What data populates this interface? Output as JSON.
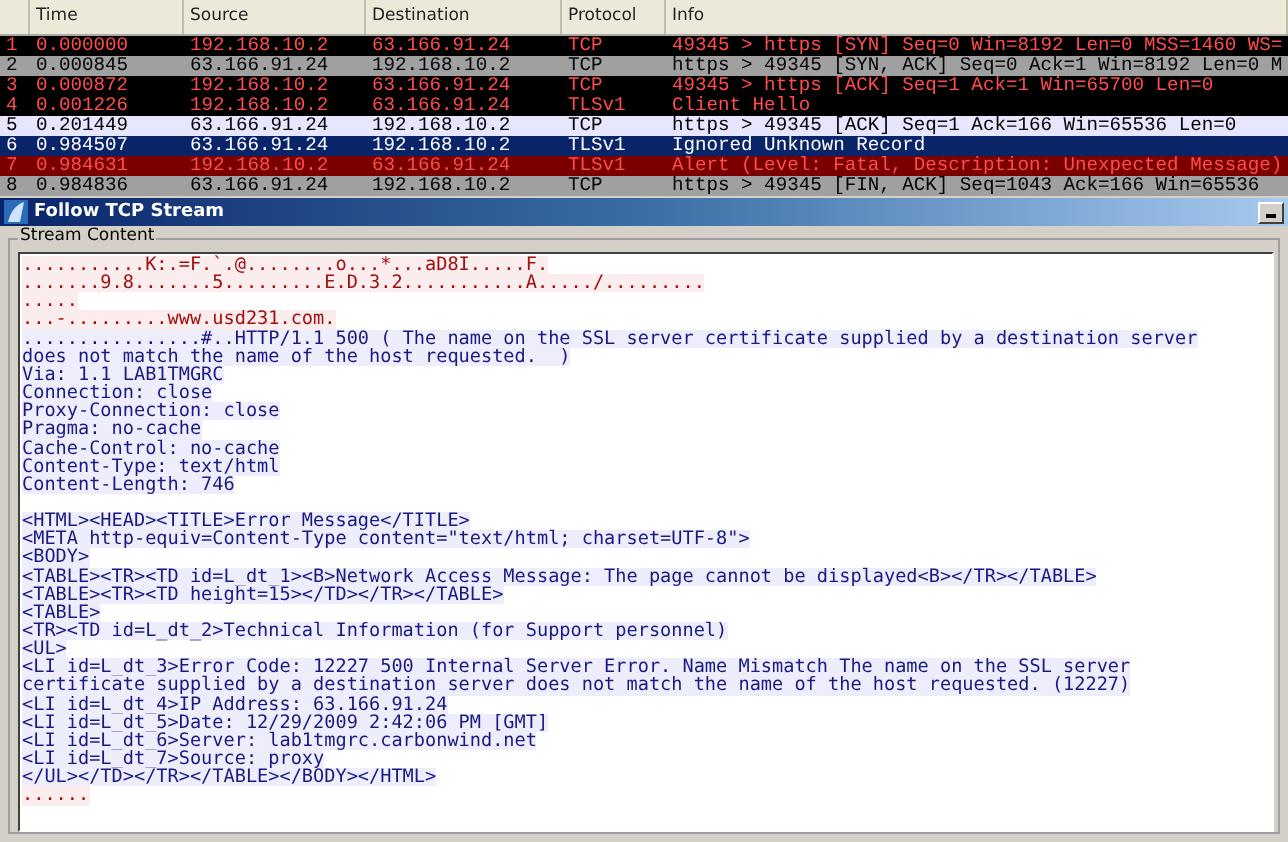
{
  "packet_list": {
    "columns": [
      "Time",
      "Source",
      "Destination",
      "Protocol",
      "Info"
    ],
    "rows": [
      {
        "no": "1",
        "time": "0.000000",
        "source": "192.168.10.2",
        "destination": "63.166.91.24",
        "protocol": "TCP",
        "info": "49345 > https [SYN] Seq=0 Win=8192 Len=0 MSS=1460 WS=",
        "color": "#000000",
        "kind": "bad",
        "selected": false
      },
      {
        "no": "2",
        "time": "0.000845",
        "source": "63.166.91.24",
        "destination": "192.168.10.2",
        "protocol": "TCP",
        "info": "https > 49345 [SYN, ACK] Seq=0 Ack=1 Win=8192 Len=0 M",
        "color": "#a0a0a0",
        "kind": "normal",
        "selected": false
      },
      {
        "no": "3",
        "time": "0.000872",
        "source": "192.168.10.2",
        "destination": "63.166.91.24",
        "protocol": "TCP",
        "info": "49345 > https [ACK] Seq=1 Ack=1 Win=65700 Len=0",
        "color": "#000000",
        "kind": "bad",
        "selected": false
      },
      {
        "no": "4",
        "time": "0.001226",
        "source": "192.168.10.2",
        "destination": "63.166.91.24",
        "protocol": "TLSv1",
        "info": "Client Hello",
        "color": "#000000",
        "kind": "bad",
        "selected": false
      },
      {
        "no": "5",
        "time": "0.201449",
        "source": "63.166.91.24",
        "destination": "192.168.10.2",
        "protocol": "TCP",
        "info": "https > 49345 [ACK] Seq=1 Ack=166 Win=65536 Len=0",
        "color": "#e7e6ff",
        "kind": "normal",
        "selected": false
      },
      {
        "no": "6",
        "time": "0.984507",
        "source": "63.166.91.24",
        "destination": "192.168.10.2",
        "protocol": "TLSv1",
        "info": "Ignored Unknown Record",
        "color": "#0a246a",
        "kind": "normal",
        "selected": true
      },
      {
        "no": "7",
        "time": "0.984631",
        "source": "192.168.10.2",
        "destination": "63.166.91.24",
        "protocol": "TLSv1",
        "info": "Alert (Level: Fatal, Description: Unexpected Message)",
        "color": "#7a0000",
        "kind": "bad",
        "selected": false
      },
      {
        "no": "8",
        "time": "0.984836",
        "source": "63.166.91.24",
        "destination": "192.168.10.2",
        "protocol": "TCP",
        "info": "https > 49345 [FIN, ACK] Seq=1043 Ack=166 Win=65536",
        "color": "#a0a0a0",
        "kind": "normal",
        "selected": false
      }
    ]
  },
  "dialog": {
    "title": "Follow TCP Stream",
    "group_label": "Stream Content",
    "blocks": [
      {
        "kind": "client",
        "lines": [
          "...........K:.=F.`.@........o...*...aD8I.....F.",
          ".......9.8.......5.........E.D.3.2...........A...../.........",
          ".....",
          "...-.........www.usd231.com."
        ]
      },
      {
        "kind": "server",
        "lines": [
          "................#..HTTP/1.1 500 ( The name on the SSL server certificate supplied by a destination server",
          "does not match the name of the host requested.  )",
          "Via: 1.1 LAB1TMGRC",
          "Connection: close",
          "Proxy-Connection: close",
          "Pragma: no-cache",
          "Cache-Control: no-cache",
          "Content-Type: text/html",
          "Content-Length: 746"
        ]
      },
      {
        "kind": "server",
        "lines": [
          "<HTML><HEAD><TITLE>Error Message</TITLE>",
          "<META http-equiv=Content-Type content=\"text/html; charset=UTF-8\">",
          "<BODY>",
          "<TABLE><TR><TD id=L_dt_1><B>Network Access Message: The page cannot be displayed<B></TR></TABLE>",
          "<TABLE><TR><TD height=15></TD></TR></TABLE>",
          "<TABLE>",
          "<TR><TD id=L_dt_2>Technical Information (for Support personnel)",
          "<UL>",
          "<LI id=L_dt_3>Error Code: 12227 500 Internal Server Error. Name Mismatch The name on the SSL server",
          "certificate supplied by a destination server does not match the name of the host requested. (12227)",
          "<LI id=L_dt_4>IP Address: 63.166.91.24",
          "<LI id=L_dt_5>Date: 12/29/2009 2:42:06 PM [GMT]",
          "<LI id=L_dt_6>Server: lab1tmgrc.carbonwind.net",
          "<LI id=L_dt_7>Source: proxy",
          "</UL></TD></TR></TABLE></BODY></HTML>"
        ]
      },
      {
        "kind": "client",
        "lines": [
          "......"
        ]
      }
    ]
  }
}
